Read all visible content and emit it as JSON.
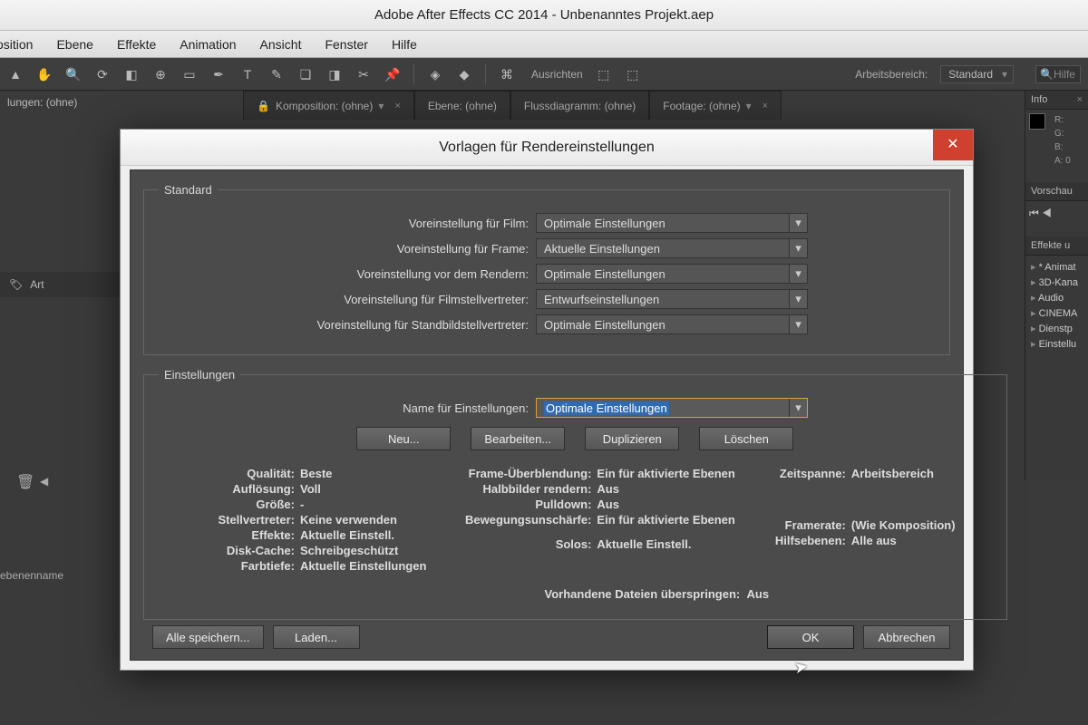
{
  "app": {
    "title": "Adobe After Effects CC 2014 - Unbenanntes Projekt.aep"
  },
  "menu": {
    "composition": "osition",
    "layer": "Ebene",
    "effects": "Effekte",
    "animation": "Animation",
    "view": "Ansicht",
    "window": "Fenster",
    "help": "Hilfe"
  },
  "toolbar": {
    "align": "Ausrichten",
    "workspace_label": "Arbeitsbereich:",
    "workspace_value": "Standard",
    "search_placeholder": "Hilfe"
  },
  "panel_tabs": {
    "comp": "Komposition: (ohne)",
    "layer": "Ebene: (ohne)",
    "flow": "Flussdiagramm: (ohne)",
    "footage": "Footage: (ohne)"
  },
  "left": {
    "item1": "lungen: (ohne)",
    "art": "Art",
    "ebenenname": "ebenenname"
  },
  "right": {
    "info": "Info",
    "r": "R:",
    "g": "G:",
    "b": "B:",
    "a": "A:  0",
    "preview": "Vorschau",
    "effects": "Effekte u",
    "e1": "* Animat",
    "e2": "3D-Kana",
    "e3": "Audio",
    "e4": "CINEMA",
    "e5": "Dienstp",
    "e6": "Einstellu"
  },
  "dialog": {
    "title": "Vorlagen für Rendereinstellungen",
    "group_standard": "Standard",
    "group_settings": "Einstellungen",
    "labels": {
      "film": "Voreinstellung für Film:",
      "frame": "Voreinstellung für Frame:",
      "prerender": "Voreinstellung vor dem Rendern:",
      "filmproxy": "Voreinstellung für Filmstellvertreter:",
      "stillproxy": "Voreinstellung für Standbildstellvertreter:",
      "name": "Name für Einstellungen:"
    },
    "values": {
      "film": "Optimale Einstellungen",
      "frame": "Aktuelle Einstellungen",
      "prerender": "Optimale Einstellungen",
      "filmproxy": "Entwurfseinstellungen",
      "stillproxy": "Optimale Einstellungen",
      "name": "Optimale Einstellungen"
    },
    "buttons": {
      "new": "Neu...",
      "edit": "Bearbeiten...",
      "dup": "Duplizieren",
      "del": "Löschen",
      "save_all": "Alle speichern...",
      "load": "Laden...",
      "ok": "OK",
      "cancel": "Abbrechen"
    },
    "detail_labels": {
      "quality": "Qualität:",
      "resolution": "Auflösung:",
      "size": "Größe:",
      "proxy": "Stellvertreter:",
      "effects": "Effekte:",
      "diskcache": "Disk-Cache:",
      "depth": "Farbtiefe:",
      "frameblend": "Frame-Überblendung:",
      "halfimg": "Halbbilder rendern:",
      "pulldown": "Pulldown:",
      "motionblur": "Bewegungsunschärfe:",
      "solos": "Solos:",
      "timespan": "Zeitspanne:",
      "framerate": "Framerate:",
      "guides": "Hilfsebenen:",
      "skip": "Vorhandene Dateien überspringen:"
    },
    "detail_values": {
      "quality": "Beste",
      "resolution": "Voll",
      "size": "-",
      "proxy": "Keine verwenden",
      "effects": "Aktuelle  Einstell.",
      "diskcache": "Schreibgeschützt",
      "depth": "Aktuelle Einstellungen",
      "frameblend": "Ein für aktivierte Ebenen",
      "halfimg": "Aus",
      "pulldown": "Aus",
      "motionblur": "Ein für aktivierte Ebenen",
      "solos": "Aktuelle  Einstell.",
      "timespan": "Arbeitsbereich",
      "framerate": "(Wie Komposition)",
      "guides": "Alle aus",
      "skip": "Aus"
    }
  }
}
